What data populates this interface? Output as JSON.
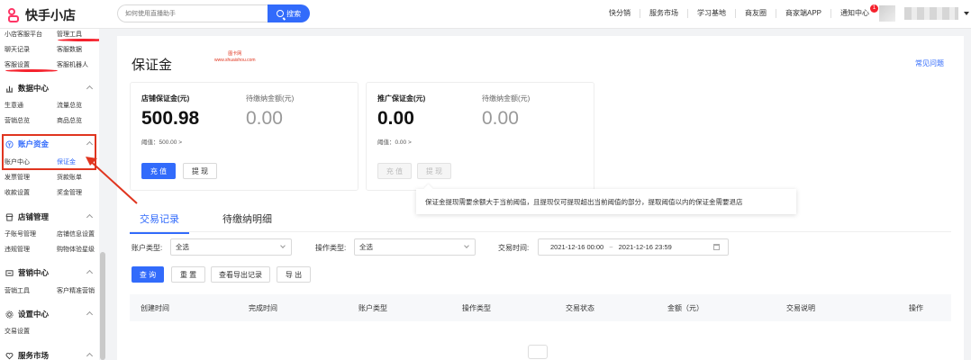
{
  "header": {
    "brand": "快手小店",
    "search_placeholder": "如何使用直播助手",
    "search_button": "搜索",
    "nav": [
      {
        "label": "快分销"
      },
      {
        "label": "服务市场"
      },
      {
        "label": "学习基地"
      },
      {
        "label": "商友圈"
      },
      {
        "label": "商家端APP"
      },
      {
        "label": "通知中心",
        "badge": "1"
      }
    ]
  },
  "sidebar": {
    "top_rows": [
      [
        "小店客服平台",
        "管理工具"
      ],
      [
        "聊天记录",
        "客服数据"
      ],
      [
        "客服设置",
        "客服机器人"
      ]
    ],
    "groups": [
      {
        "title": "数据中心",
        "rows": [
          [
            "生意通",
            "流量总览"
          ],
          [
            "营销总览",
            "商品总览"
          ]
        ]
      },
      {
        "title": "账户资金",
        "rows": [
          [
            "账户中心",
            "保证金"
          ],
          [
            "发票管理",
            "货款账单"
          ],
          [
            "收款设置",
            "奖金管理"
          ]
        ]
      },
      {
        "title": "店铺管理",
        "rows": [
          [
            "子账号管理",
            "店铺信息设置"
          ],
          [
            "违规管理",
            "购物体验星级"
          ]
        ]
      },
      {
        "title": "营销中心",
        "rows": [
          [
            "营销工具",
            "客户精准营销"
          ]
        ]
      },
      {
        "title": "设置中心",
        "rows": [
          [
            "交易设置",
            ""
          ]
        ]
      },
      {
        "title": "服务市场",
        "rows": []
      }
    ]
  },
  "main": {
    "title": "保证金",
    "watermark_line1": "图卡网",
    "watermark_line2": "www.shuaishou.com",
    "faq": "常见问题",
    "store_card": {
      "label": "店铺保证金(元)",
      "value": "500.98",
      "pending_label": "待缴纳金额(元)",
      "pending_value": "0.00",
      "threshold": "阈值：500.00",
      "recharge": "充 值",
      "withdraw": "提 现"
    },
    "promo_card": {
      "label": "推广保证金(元)",
      "value": "0.00",
      "pending_label": "待缴纳金额(元)",
      "pending_value": "0.00",
      "threshold": "阈值：0.00",
      "recharge": "充 值",
      "withdraw": "提 现"
    },
    "tooltip": "保证金提现需要余额大于当前阈值，且提现仅可提现超出当前阈值的部分，提取阈值以内的保证金需要退店",
    "tabs": [
      {
        "label": "交易记录",
        "active": true
      },
      {
        "label": "待缴纳明细",
        "active": false
      }
    ],
    "filters": {
      "account_type_label": "账户类型:",
      "account_type_value": "全选",
      "op_type_label": "操作类型:",
      "op_type_value": "全选",
      "time_label": "交易时间:",
      "start": "2021-12-16 00:00",
      "sep": "~",
      "end": "2021-12-16 23:59"
    },
    "actions": {
      "query": "查 询",
      "reset": "重 置",
      "export_log": "查看导出记录",
      "export": "导 出"
    },
    "table_headers": [
      "创建时间",
      "完成时间",
      "账户类型",
      "操作类型",
      "交易状态",
      "金额（元）",
      "交易说明",
      "操作"
    ]
  },
  "colors": {
    "brand": "#fe3666",
    "primary": "#326bfb",
    "annotation": "#e0351f"
  }
}
